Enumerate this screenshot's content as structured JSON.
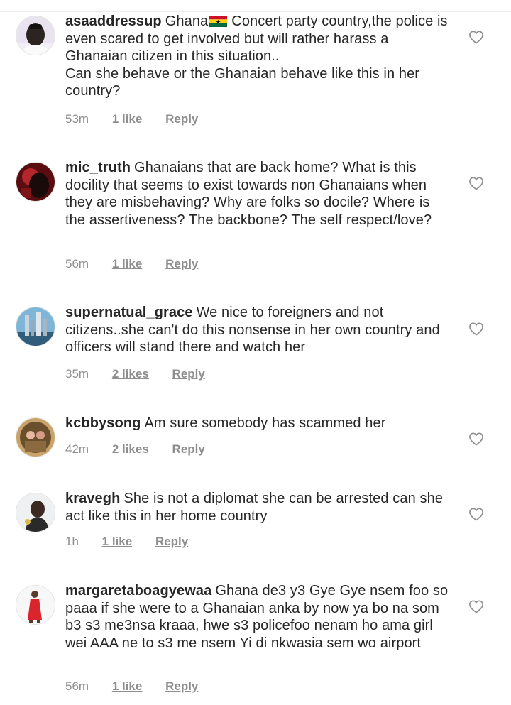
{
  "comments": [
    {
      "username": "asaaddressup",
      "text_before_flag": "Ghana",
      "text": "Concert party country,the police is even scared to get involved but will rather harass a Ghanaian citizen in this situation..",
      "extra": "Can she behave or the Ghanaian behave like this in her country?",
      "time": "53m",
      "likes": "1 like",
      "reply": "Reply"
    },
    {
      "username": "mic_truth",
      "text": "Ghanaians that are back home? What is this docility that seems to exist towards non Ghanaians when they are misbehaving? Why are folks so docile? Where is the assertiveness? The backbone? The self respect/love?",
      "time": "56m",
      "likes": "1 like",
      "reply": "Reply"
    },
    {
      "username": "supernatual_grace",
      "text": "We nice to foreigners and not citizens..she can't do this nonsense in her own country and officers will stand there and watch her",
      "time": "35m",
      "likes": "2 likes",
      "reply": "Reply"
    },
    {
      "username": "kcbbysong",
      "text": "Am sure somebody has scammed her",
      "time": "42m",
      "likes": "2 likes",
      "reply": "Reply"
    },
    {
      "username": "kravegh",
      "text": "She is not a diplomat she can be arrested can she act like this in her home country",
      "time": "1h",
      "likes": "1 like",
      "reply": "Reply"
    },
    {
      "username": "margaretaboagyewaa",
      "text": "Ghana de3 y3 Gye Gye nsem foo so paaa if she were to a Ghanaian anka by now ya bo na som b3 s3 me3nsa kraaa,  hwe s3 policefoo nenam ho ama girl wei AAA ne to s3 me nsem Yi di nkwasia sem wo airport",
      "time": "56m",
      "likes": "1 like",
      "reply": "Reply"
    }
  ],
  "icons": {
    "like": "heart-outline-icon",
    "flag": "ghana-flag-emoji"
  },
  "colors": {
    "text": "#262626",
    "meta": "#8e8e8e",
    "heart_stroke": "#8e8e8e"
  }
}
